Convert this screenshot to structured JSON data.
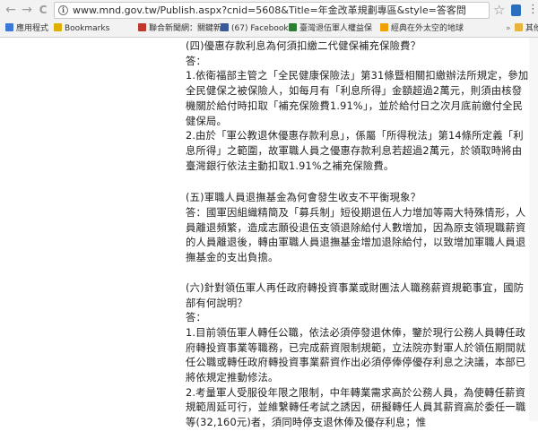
{
  "browser": {
    "back_glyph": "←",
    "forward_glyph": "→",
    "reload_glyph": "C",
    "url": "www.mnd.gov.tw/Publish.aspx?cnid=5608&Title=年金改革規劃專區&style=答客問",
    "menu_glyph": "⋮"
  },
  "bookmarks": {
    "items": [
      {
        "label": "應用程式",
        "icon_color": "#3b78d8"
      },
      {
        "label": "Bookmarks",
        "icon_color": "#e0b000"
      },
      {
        "label": "聯合新聞網：關鍵新",
        "icon_color": "#c0392b"
      },
      {
        "label": "(67) Facebook",
        "icon_color": "#3b5998"
      },
      {
        "label": "臺灣退伍軍人權益保",
        "icon_color": "#2e7d32"
      },
      {
        "label": "經典在外太空的地球",
        "icon_color": "#f0a000"
      }
    ],
    "more": "»",
    "other": "其他書籤"
  },
  "article": {
    "q4_title": "(四)優惠存款利息為何須扣繳二代健保補充保險費？",
    "q4_answer_label": "答：",
    "q4_p1": "1.依衛福部主管之「全民健康保險法」第31條暨相關扣繳辦法所規定，參加全民健保之被保險人，如每月有「利息所得」金額超過2萬元，則須由核發機關於給付時扣取「補充保險費1.91%」，並於給付日之次月底前繳付全民健保局。",
    "q4_p2": "2.由於「軍公教退休優惠存款利息」，係屬「所得稅法」第14條所定義「利息所得」之範圍，故軍職人員之優惠存款利息若超過2萬元，於領取時將由臺灣銀行依法主動扣取1.91%之補充保險費。",
    "q5_title": "(五)軍職人員退撫基金為何會發生收支不平衡現象？",
    "q5_answer": "答：國軍因組織精簡及「募兵制」短役期退伍人力增加等兩大特殊情形，人員離退頻繁，造成志願役退伍支領退除給付人數增加，因為原支領現職薪資的人員離退後，轉由軍職人員退撫基金增加退除給付，以致增加軍職人員退撫基金的支出負擔。",
    "q6_title": "(六)針對領伍軍人再任政府轉投資事業或財團法人職務薪資規範事宜，國防部有何說明？",
    "q6_answer_label": "答：",
    "q6_p1": "1.目前領伍軍人轉任公職，依法必須停發退休俸，鑒於現行公務人員轉任政府轉投資事業等職務，已完成薪資限制規範，立法院亦對軍人於領伍期間就任公職或轉任政府轉投資事業薪資作出必須停俸停優存利息之決議，本部已將依規定推動修法。",
    "q6_p2": "2.考量軍人受服役年限之限制，中年轉業需求高於公務人員，為使轉任薪資規範周延可行，並維繫轉任考試之誘因，研擬轉任人員其薪資高於委任一職等(32,160元)者，須同時停支退休俸及優存利息；惟"
  }
}
